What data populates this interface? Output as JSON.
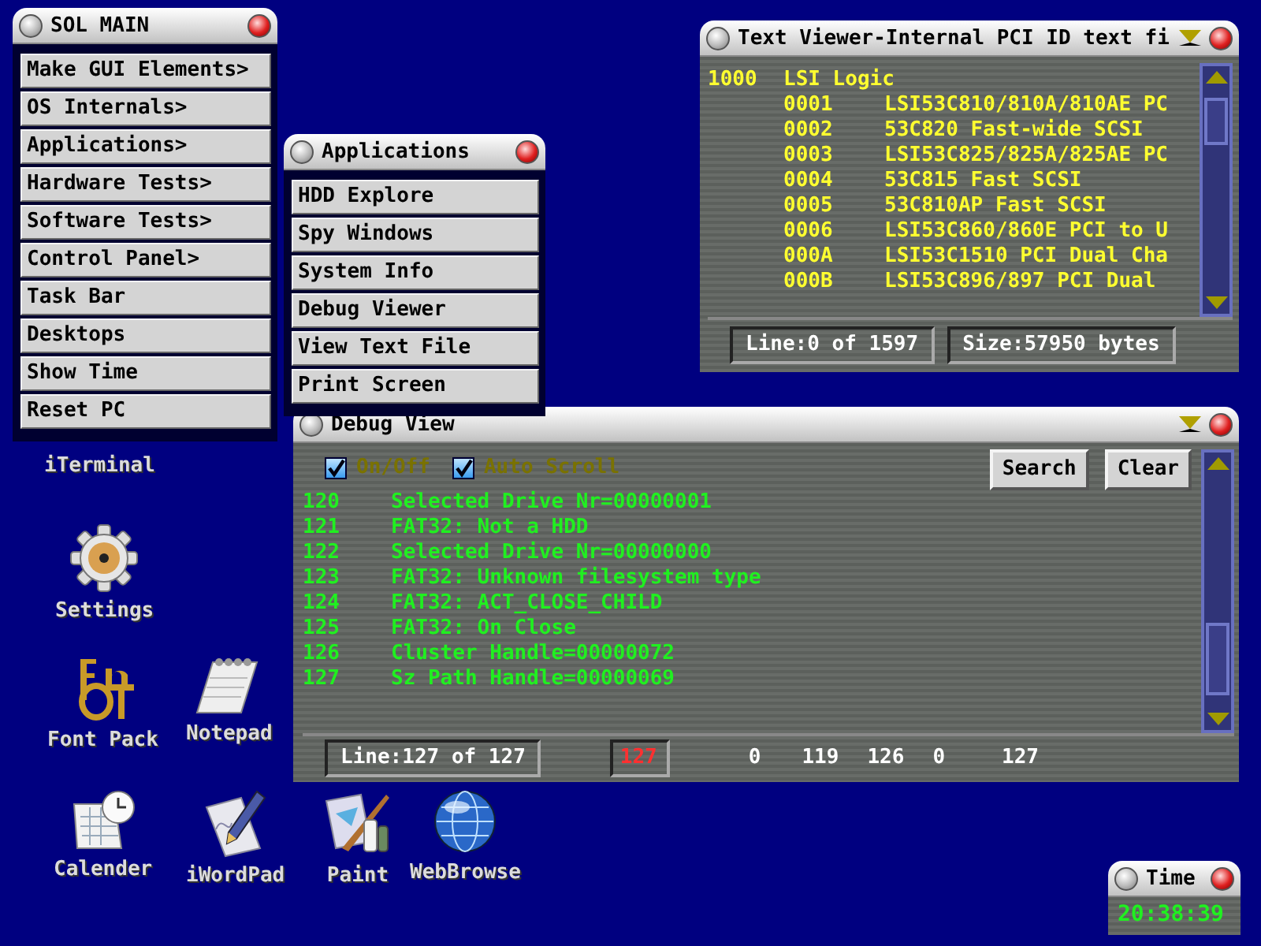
{
  "desktop_icons": [
    {
      "label": "iTerminal",
      "kind": "terminal"
    },
    {
      "label": "Settings",
      "kind": "settings"
    },
    {
      "label": "Font Pack",
      "kind": "fontpack"
    },
    {
      "label": "Notepad",
      "kind": "notepad"
    },
    {
      "label": "Calender",
      "kind": "calendar"
    },
    {
      "label": "iWordPad",
      "kind": "wordpad"
    },
    {
      "label": "Paint",
      "kind": "paint"
    },
    {
      "label": "WebBrowse",
      "kind": "browser"
    }
  ],
  "sol_main": {
    "title": "SOL MAIN",
    "items": [
      "Make GUI Elements>",
      "OS Internals>",
      "Applications>",
      "Hardware Tests>",
      "Software Tests>",
      "Control Panel>",
      "Task Bar",
      "Desktops",
      "Show Time",
      "Reset PC"
    ]
  },
  "text_viewer": {
    "title": "Text Viewer-Internal PCI ID text fi",
    "entries": [
      {
        "id": "1000",
        "name": "LSI Logic",
        "children": [
          {
            "id": "0001",
            "name": "LSI53C810/810A/810AE PC"
          },
          {
            "id": "0002",
            "name": "53C820 Fast-wide SCSI"
          },
          {
            "id": "0003",
            "name": "LSI53C825/825A/825AE PC"
          },
          {
            "id": "0004",
            "name": "53C815 Fast SCSI"
          },
          {
            "id": "0005",
            "name": "53C810AP Fast SCSI"
          },
          {
            "id": "0006",
            "name": "LSI53C860/860E PCI to U"
          },
          {
            "id": "000A",
            "name": "LSI53C1510 PCI Dual Cha"
          },
          {
            "id": "000B",
            "name": "LSI53C896/897 PCI Dual"
          }
        ]
      }
    ],
    "status": [
      "Line:0 of 1597",
      "Size:57950 bytes"
    ]
  },
  "debug_view": {
    "title": "Debug View",
    "options": [
      {
        "label": "On/Off",
        "checked": true
      },
      {
        "label": "Auto Scroll",
        "checked": true
      }
    ],
    "buttons": [
      "Search",
      "Clear"
    ],
    "log": [
      {
        "line": "120",
        "message": "Selected Drive Nr=00000001"
      },
      {
        "line": "121",
        "message": "FAT32: Not a HDD"
      },
      {
        "line": "122",
        "message": "Selected Drive Nr=00000000"
      },
      {
        "line": "123",
        "message": "FAT32: Unknown filesystem type"
      },
      {
        "line": "124",
        "message": "FAT32: ACT_CLOSE_CHILD"
      },
      {
        "line": "125",
        "message": "FAT32: On Close"
      },
      {
        "line": "126",
        "message": "Cluster Handle=00000072"
      },
      {
        "line": "127",
        "message": "Sz Path Handle=00000069"
      }
    ],
    "status": {
      "line": "Line:127 of 127",
      "fields": [
        {
          "text": "127",
          "kind": "boxed"
        },
        {
          "text": "0",
          "kind": "plain"
        },
        {
          "text": "119",
          "kind": "plain"
        },
        {
          "text": "126",
          "kind": "plain"
        },
        {
          "text": "0",
          "kind": "plain"
        },
        {
          "text": "127",
          "kind": "plain"
        }
      ]
    }
  },
  "applications_menu": {
    "title": "Applications",
    "items": [
      "HDD Explore",
      "Spy Windows",
      "System Info",
      "Debug Viewer",
      "View Text File",
      "Print Screen"
    ]
  },
  "clock": {
    "title": "Time",
    "time": "20:38:39"
  }
}
